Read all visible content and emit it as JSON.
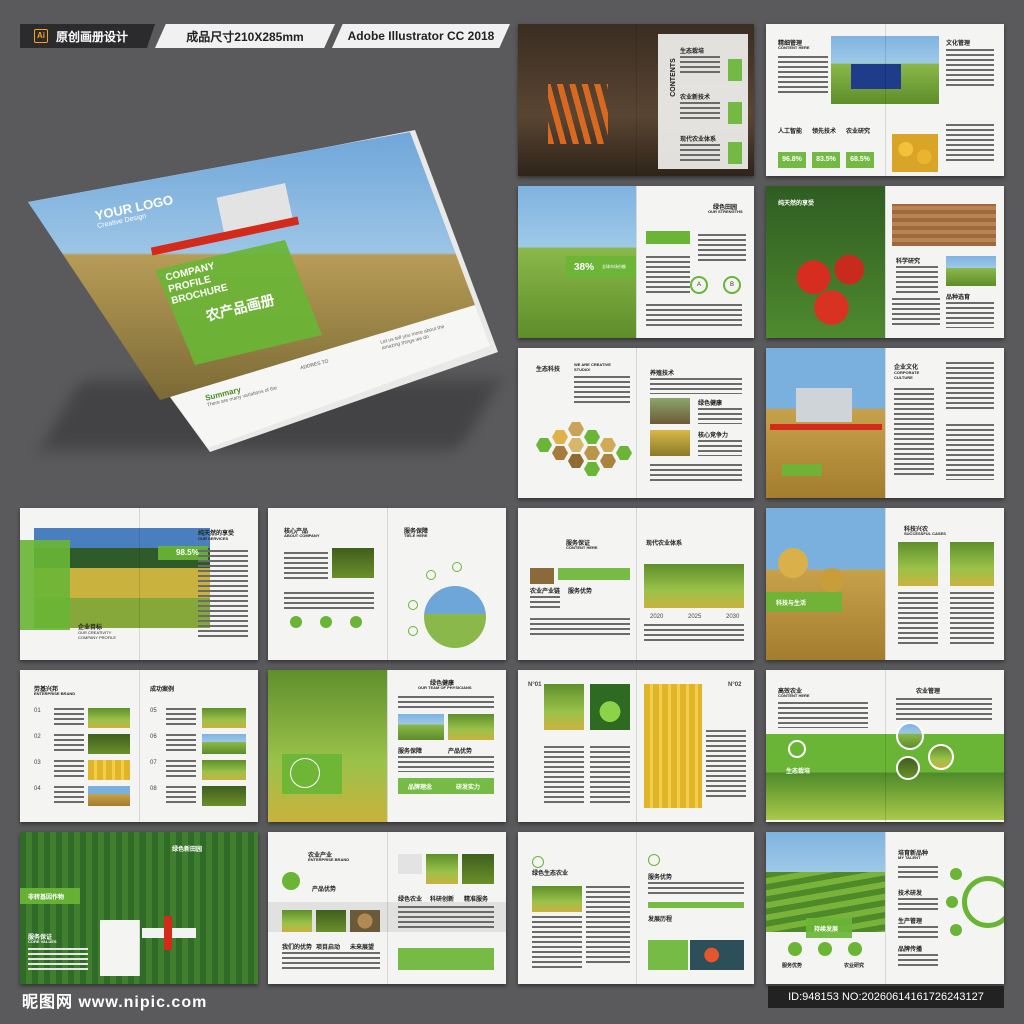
{
  "header": {
    "tag1": "原创画册设计",
    "tag2": "成品尺寸210X285mm",
    "tag3": "Adobe Illustrator CC 2018"
  },
  "cover": {
    "logo": "YOUR LOGO",
    "logo_sub": "Creative Design",
    "profile_1": "COMPANY",
    "profile_2": "PROFILE",
    "profile_3": "BROCHURE",
    "title_cn": "农产品画册",
    "summary": "Summary",
    "summary_text": "There are many variations of the",
    "address": "ADDRES TO",
    "stat_text": "Let us tell you more about the amazing things we do"
  },
  "pages": {
    "contents": "CONTENTS",
    "p1_items": [
      "生态栽培",
      "农业新技术",
      "现代农业体系"
    ],
    "s2_title": "精细管理",
    "s2_sub": "CONTENT HERE",
    "s2_culture": "文化管理",
    "s2_stats": [
      "96.8%",
      "83.5%",
      "68.5%"
    ],
    "s2_stat_labels": [
      "人工智能",
      "领先技术",
      "农业研究"
    ],
    "s3_title": "绿色田园",
    "s3_sub": "OUR STRENGTHS",
    "s3_stat": "38%",
    "s3_stat_label": "全球市场份额",
    "s3_ab": [
      "A",
      "B"
    ],
    "s4_title": "纯天然的享受",
    "s4_items": [
      "科学研究",
      "品种选育"
    ],
    "s5_title": "生态科技",
    "s5_sub": "WE ARE CREATIVE STUDIO!",
    "s5_tech": "养殖技术",
    "s5_items": [
      "绿色健康",
      "核心竞争力"
    ],
    "s6_title": "企业文化",
    "s6_sub": "CORPORATE CULTURE",
    "s7_title": "纯天然的享受",
    "s7_sub": "OUR SERVICES",
    "s7_stat": "98.5%",
    "s7_label": "企业目标",
    "s7_label_en": "OUR CREATIVITY COMPANY PROFILE",
    "s8_title": "核心产品",
    "s8_sub": "ABOUT COMPANY",
    "s8_service": "服务保障",
    "s8_service_sub": "TIELE HERE",
    "s9_title": "服务保证",
    "s9_sub": "CONTENT HERE",
    "s9_title2": "现代农业体系",
    "s9_years": [
      "2020",
      "2025",
      "2030"
    ],
    "s9_items": [
      "农业产业链",
      "服务优势"
    ],
    "s10_title": "科技兴农",
    "s10_sub": "SUCCESSFUL CASES",
    "s10_label": "科技与生活",
    "s11_title": "劳基兴邦",
    "s11_sub": "ENTERPRISE BRAND",
    "s11_cases": "成功案例",
    "s11_nums": [
      "01",
      "02",
      "03",
      "04",
      "05",
      "06",
      "07",
      "08"
    ],
    "s12_title": "绿色健康",
    "s12_sub": "OUR TEAM OF PHYSICIANS",
    "s12_items": [
      "服务保障",
      "产品优势",
      "品牌理念",
      "研发实力"
    ],
    "s13_n1": "N°01",
    "s13_n2": "N°02",
    "s14_title": "高效农业",
    "s14_sub": "CONTENT HERE",
    "s14_title2": "农业管理",
    "s14_label": "生态栽培",
    "s15_title": "绿色新田园",
    "s15_label": "非转基因作物",
    "s15_service": "服务保证",
    "s15_service_sub": "CORE VALUES",
    "s16_title": "农业产业",
    "s16_sub": "ENTERPRISE BRAND",
    "s16_items": [
      "产品优势",
      "绿色农业",
      "科研创新",
      "精准服务",
      "我们的优势",
      "项目启动",
      "未来展望"
    ],
    "s17_title": "绿色生态农业",
    "s17_items": [
      "服务优势",
      "发展历程"
    ],
    "s18_title": "培育新品种",
    "s18_sub": "MY TALENT",
    "s18_label": "持续发展",
    "s18_items": [
      "服务优势",
      "技术研发",
      "生产管理",
      "品牌传播",
      "农业研究"
    ]
  },
  "footer": {
    "watermark": "昵图网 www.nipic.com",
    "id": "ID:948153 NO:20260614161726243127"
  },
  "colors": {
    "accent": "#6ab536",
    "background": "#5a5a5c"
  }
}
